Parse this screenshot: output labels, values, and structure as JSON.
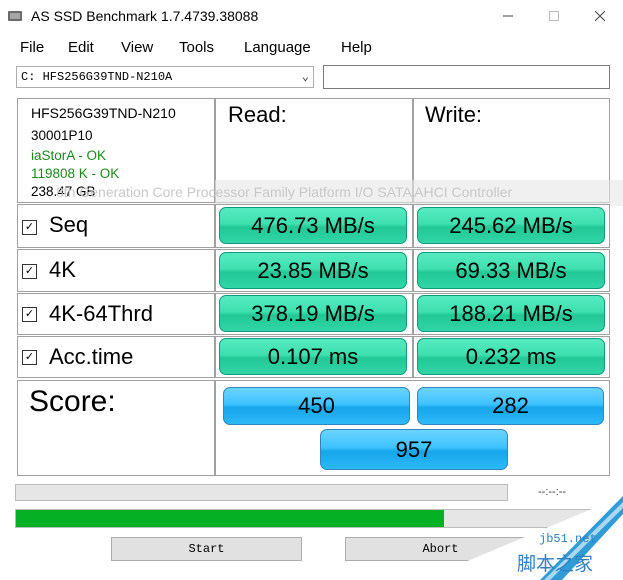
{
  "window": {
    "title": "AS SSD Benchmark 1.7.4739.38088"
  },
  "menu": [
    "File",
    "Edit",
    "View",
    "Tools",
    "Language",
    "Help"
  ],
  "drive_select": {
    "value": "C: HFS256G39TND-N210A"
  },
  "search_input": {
    "value": ""
  },
  "info": {
    "model": "HFS256G39TND-N210",
    "firmware": "30001P10",
    "driver": "iaStorA - OK",
    "alignment": "119808 K - OK",
    "size": "238.47 GB"
  },
  "overlay_text": "8th Generation Core Processor Family Platform I/O SATA AHCI Controller",
  "headers": {
    "read": "Read:",
    "write": "Write:"
  },
  "rows": [
    {
      "label": "Seq",
      "checked": true,
      "read": "476.73 MB/s",
      "write": "245.62 MB/s"
    },
    {
      "label": "4K",
      "checked": true,
      "read": "23.85 MB/s",
      "write": "69.33 MB/s"
    },
    {
      "label": "4K-64Thrd",
      "checked": true,
      "read": "378.19 MB/s",
      "write": "188.21 MB/s"
    },
    {
      "label": "Acc.time",
      "checked": true,
      "read": "0.107 ms",
      "write": "0.232 ms"
    }
  ],
  "score": {
    "label": "Score:",
    "read": "450",
    "write": "282",
    "total": "957"
  },
  "progress": {
    "timer": "--:--:--",
    "main_fill": 0.72
  },
  "buttons": {
    "start": "Start",
    "abort": "Abort"
  },
  "watermark": {
    "site": "jb51.net",
    "brand": "脚本之家"
  },
  "colors": {
    "progress_green": "#06b025",
    "status_green": "#1a8a1a"
  }
}
